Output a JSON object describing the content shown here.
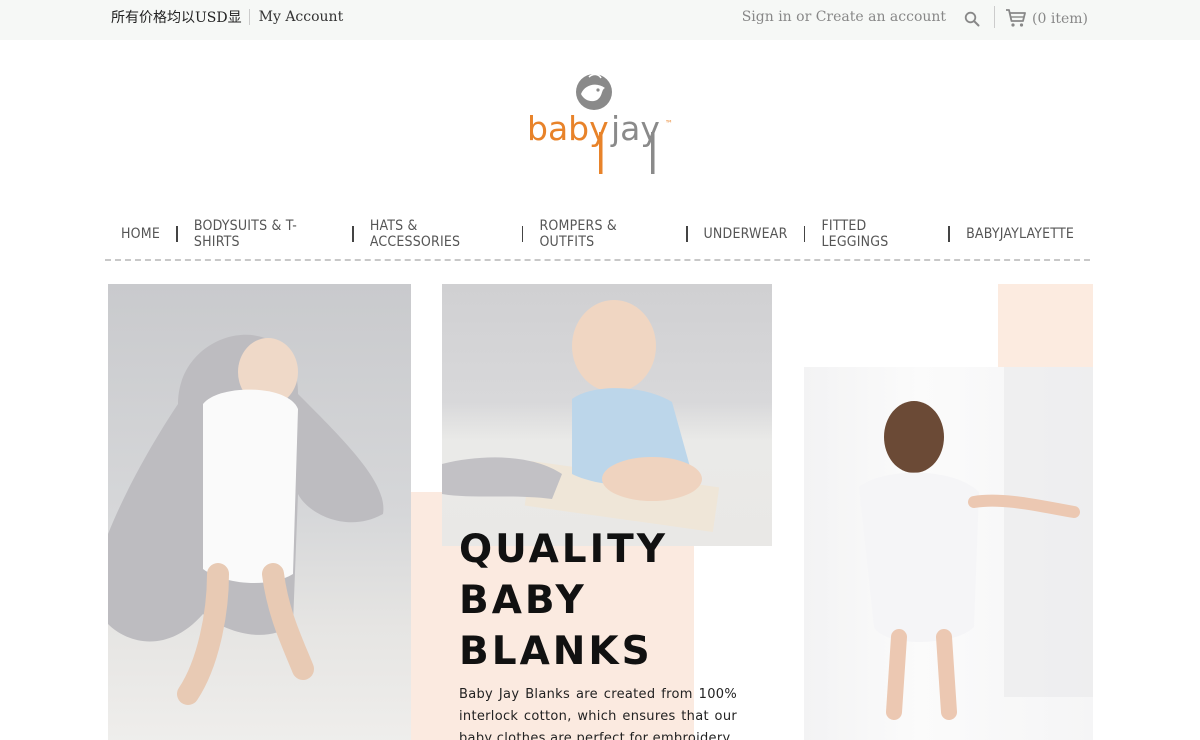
{
  "topbar": {
    "currency_notice": "所有价格均以USD显",
    "my_account": "My Account",
    "sign_in": "Sign in or Create an account",
    "cart_count": "(0 item)"
  },
  "logo": {
    "text_baby": "baby",
    "text_jay": "jay",
    "tm": "™"
  },
  "nav": {
    "items": [
      "HOME",
      "BODYSUITS & T-SHIRTS",
      "HATS & ACCESSORIES",
      "ROMPERS & OUTFITS",
      "UNDERWEAR",
      "FITTED LEGGINGS",
      "BABYJAYLAYETTE"
    ]
  },
  "hero": {
    "headline_line1": "QUALITY",
    "headline_line2": "BABY",
    "headline_line3": "BLANKS",
    "body": "Baby Jay Blanks are created from 100% interlock cotton, which ensures that our baby clothes are perfect for embroidery"
  },
  "colors": {
    "accent_orange": "#e8832a",
    "logo_gray": "#8a8a8a",
    "peach": "#fbeae0",
    "topbar_bg": "#f6f8f6"
  },
  "icons": [
    "search-icon",
    "cart-icon",
    "bird-logo-icon"
  ]
}
